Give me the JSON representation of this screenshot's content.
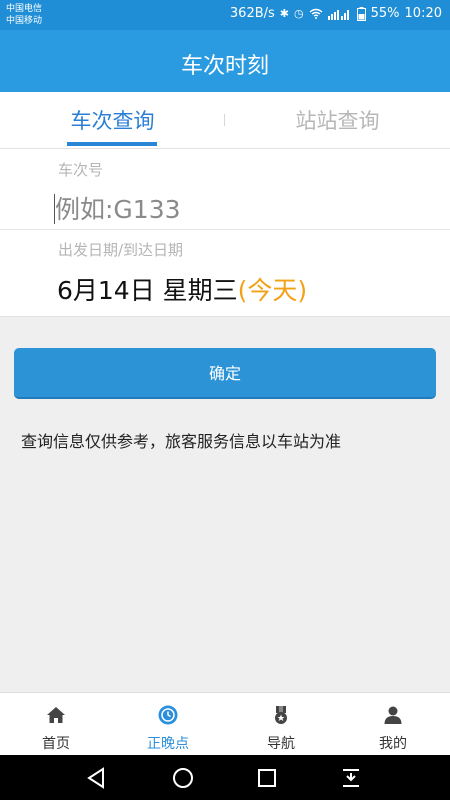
{
  "status_bar": {
    "carrier1": "中国电信",
    "carrier2": "中国移动",
    "speed": "362B/s",
    "battery": "55%",
    "time": "10:20",
    "icons": [
      "bluetooth-icon",
      "alarm-icon",
      "wifi-icon",
      "signal-icon",
      "battery-icon"
    ]
  },
  "header": {
    "title": "车次时刻"
  },
  "tabs": [
    {
      "label": "车次查询",
      "active": true
    },
    {
      "label": "站站查询",
      "active": false
    }
  ],
  "form": {
    "train_label": "车次号",
    "train_placeholder": "例如:G133",
    "train_value": "",
    "date_label": "出发日期/到达日期",
    "date_value": "6月14日 星期三",
    "date_today": "(今天)"
  },
  "confirm_label": "确定",
  "note": "查询信息仅供参考，旅客服务信息以车站为准",
  "bottom_nav": [
    {
      "label": "首页",
      "icon": "home-icon",
      "active": false
    },
    {
      "label": "正晚点",
      "icon": "clock-icon",
      "active": true
    },
    {
      "label": "导航",
      "icon": "medal-icon",
      "active": false
    },
    {
      "label": "我的",
      "icon": "user-icon",
      "active": false
    }
  ],
  "colors": {
    "primary": "#2a9be0",
    "accent_orange": "#f2a218",
    "active_tab": "#2a7fd4"
  }
}
